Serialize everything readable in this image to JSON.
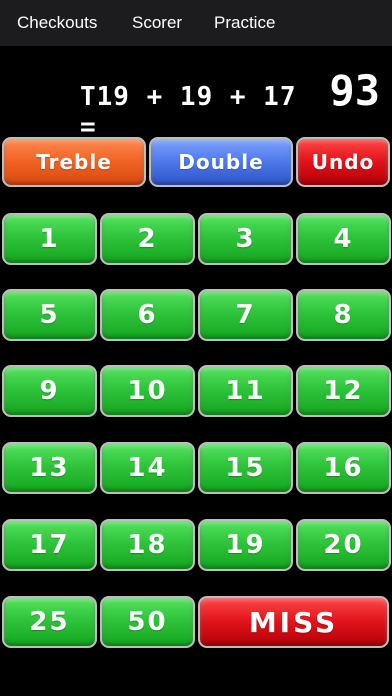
{
  "nav": {
    "checkouts": "Checkouts",
    "scorer": "Scorer",
    "practice": "Practice"
  },
  "calc": {
    "expression": "T19 + 19 + 17 =",
    "total": "93"
  },
  "modifiers": {
    "treble": "Treble",
    "double": "Double",
    "undo": "Undo"
  },
  "numbers": [
    "1",
    "2",
    "3",
    "4",
    "5",
    "6",
    "7",
    "8",
    "9",
    "10",
    "11",
    "12",
    "13",
    "14",
    "15",
    "16",
    "17",
    "18",
    "19",
    "20"
  ],
  "special": {
    "bull25": "25",
    "bull50": "50",
    "miss": "MISS"
  }
}
